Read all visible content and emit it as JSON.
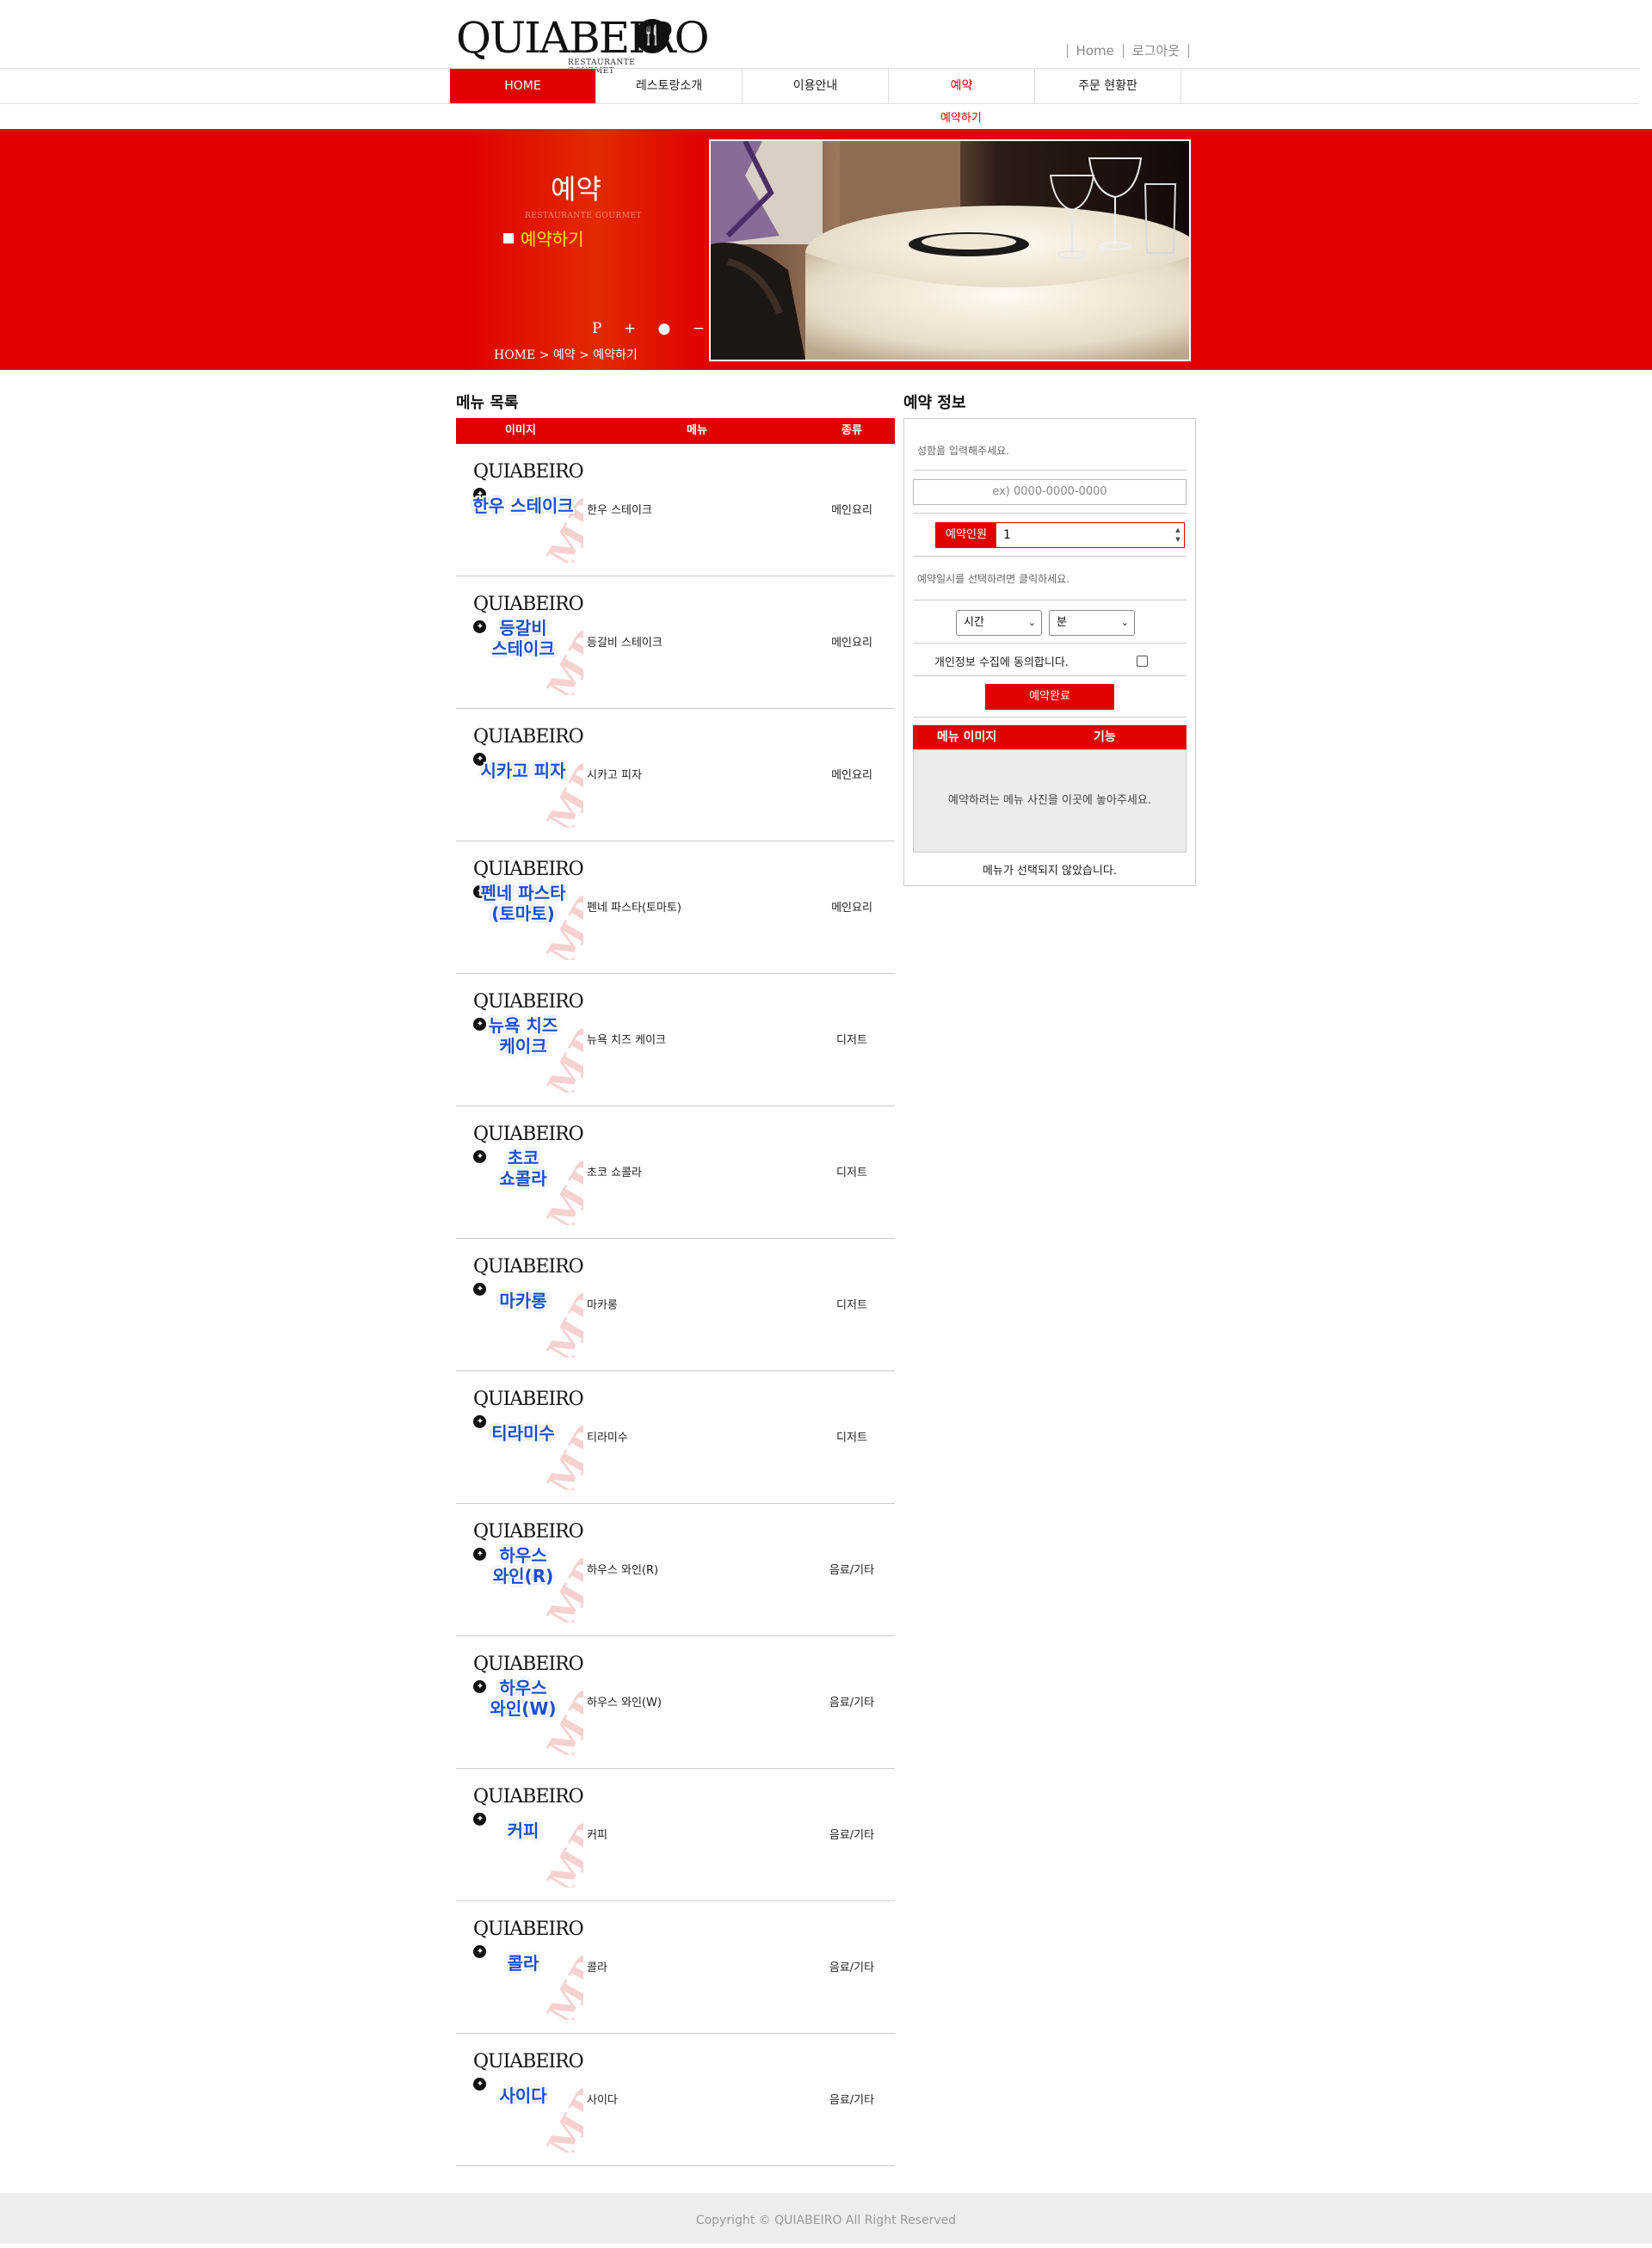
{
  "header": {
    "logo": {
      "text": "QUIABEIRO",
      "sub": "RESTAURANTE GOURMET"
    },
    "links": [
      {
        "label": "Home"
      },
      {
        "label": "로그아웃"
      }
    ]
  },
  "nav": {
    "items": [
      {
        "label": "HOME"
      },
      {
        "label": "레스토랑소개"
      },
      {
        "label": "이용안내"
      },
      {
        "label": "예약"
      },
      {
        "label": "주문 현황판"
      }
    ],
    "active": "예약",
    "sub_item": "예약하기"
  },
  "banner": {
    "title": "예약",
    "subtitle": "RESTAURANTE GOURMET",
    "item": "예약하기",
    "controls": "P + ● −",
    "breadcrumb": "HOME > 예약 > 예약하기"
  },
  "menu_list": {
    "title": "메뉴 목록",
    "columns": [
      "이미지",
      "메뉴",
      "종류"
    ],
    "thumb_logo": "QUIABEIRO",
    "thumb_watermark": "SAMPLE",
    "rows": [
      {
        "image_text": "한우 스테이크",
        "name": "한우 스테이크",
        "kind": "메인요리"
      },
      {
        "image_text": "등갈비\n스테이크",
        "name": "등갈비 스테이크",
        "kind": "메인요리"
      },
      {
        "image_text": "시카고 피자",
        "name": "시카고 피자",
        "kind": "메인요리"
      },
      {
        "image_text": "펜네 파스타\n(토마토)",
        "name": "펜네 파스타(토마토)",
        "kind": "메인요리"
      },
      {
        "image_text": "뉴욕 치즈\n케이크",
        "name": "뉴욕 치즈 케이크",
        "kind": "디저트"
      },
      {
        "image_text": "초코\n쇼콜라",
        "name": "초코 쇼콜라",
        "kind": "디저트"
      },
      {
        "image_text": "마카롱",
        "name": "마카롱",
        "kind": "디저트"
      },
      {
        "image_text": "티라미수",
        "name": "티라미수",
        "kind": "디저트"
      },
      {
        "image_text": "하우스\n와인(R)",
        "name": "하우스 와인(R)",
        "kind": "음료/기타"
      },
      {
        "image_text": "하우스\n와인(W)",
        "name": "하우스 와인(W)",
        "kind": "음료/기타"
      },
      {
        "image_text": "커피",
        "name": "커피",
        "kind": "음료/기타"
      },
      {
        "image_text": "콜라",
        "name": "콜라",
        "kind": "음료/기타"
      },
      {
        "image_text": "사이다",
        "name": "사이다",
        "kind": "음료/기타"
      }
    ]
  },
  "reservation": {
    "title": "예약 정보",
    "name_hint": "성함을 입력해주세요.",
    "phone_placeholder": "ex) 0000-0000-0000",
    "count_label": "예약인원",
    "count_value": "1",
    "date_hint": "예약일시를 선택하려면 클릭하세요.",
    "hour_select": "시간",
    "minute_select": "분",
    "agree_label": "개인정보 수집에 동의합니다.",
    "agree_checked": false,
    "submit_label": "예약완료",
    "image_columns": [
      "메뉴 이미지",
      "기능"
    ],
    "image_drop_hint": "예약하려는 메뉴 사진을 이곳에 놓아주세요.",
    "no_menu_note": "메뉴가 선택되지 않았습니다."
  },
  "footer": {
    "copyright": "Copyright © QUIABEIRO All Right Reserved"
  },
  "colors": {
    "accent": "#e00000",
    "banner": "#e20000",
    "highlight": "#ffe100",
    "footer_bg": "#ededed"
  }
}
